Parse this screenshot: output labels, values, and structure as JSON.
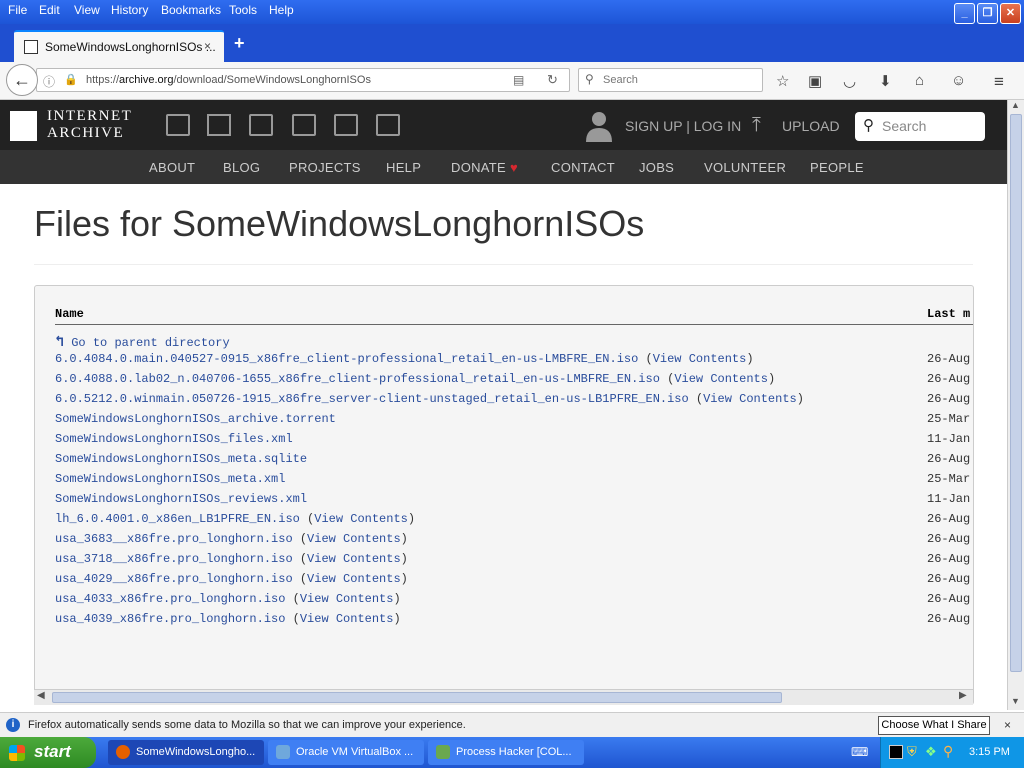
{
  "menu": [
    "File",
    "Edit",
    "View",
    "History",
    "Bookmarks",
    "Tools",
    "Help"
  ],
  "tab": {
    "title": "SomeWindowsLonghornISOs ...",
    "close": "×",
    "new_tab": "+"
  },
  "urlbar": {
    "scheme": "https://",
    "host": "archive.org",
    "path": "/download/SomeWindowsLonghornISOs"
  },
  "search": {
    "placeholder": "Search"
  },
  "ia": {
    "logo_line1": "INTERNET",
    "logo_line2": "ARCHIVE",
    "signup": "SIGN UP | LOG IN",
    "upload": "UPLOAD",
    "search_placeholder": "Search",
    "nav": [
      "ABOUT",
      "BLOG",
      "PROJECTS",
      "HELP",
      "DONATE",
      "CONTACT",
      "JOBS",
      "VOLUNTEER",
      "PEOPLE"
    ],
    "heart_color": "#d6282f"
  },
  "page": {
    "title": "Files for SomeWindowsLonghornISOs",
    "col_name": "Name",
    "col_last": "Last m",
    "parent": "Go to parent directory",
    "view_contents": "View Contents",
    "files": [
      {
        "name": "6.0.4084.0.main.040527-0915_x86fre_client-professional_retail_en-us-LMBFRE_EN.iso",
        "vc": true,
        "date": "26-Aug"
      },
      {
        "name": "6.0.4088.0.lab02_n.040706-1655_x86fre_client-professional_retail_en-us-LMBFRE_EN.iso",
        "vc": true,
        "date": "26-Aug"
      },
      {
        "name": "6.0.5212.0.winmain.050726-1915_x86fre_server-client-unstaged_retail_en-us-LB1PFRE_EN.iso",
        "vc": true,
        "date": "26-Aug"
      },
      {
        "name": "SomeWindowsLonghornISOs_archive.torrent",
        "vc": false,
        "date": "25-Mar"
      },
      {
        "name": "SomeWindowsLonghornISOs_files.xml",
        "vc": false,
        "date": "11-Jan"
      },
      {
        "name": "SomeWindowsLonghornISOs_meta.sqlite",
        "vc": false,
        "date": "26-Aug"
      },
      {
        "name": "SomeWindowsLonghornISOs_meta.xml",
        "vc": false,
        "date": "25-Mar"
      },
      {
        "name": "SomeWindowsLonghornISOs_reviews.xml",
        "vc": false,
        "date": "11-Jan"
      },
      {
        "name": "lh_6.0.4001.0_x86en_LB1PFRE_EN.iso",
        "vc": true,
        "date": "26-Aug"
      },
      {
        "name": "usa_3683__x86fre.pro_longhorn.iso",
        "vc": true,
        "date": "26-Aug"
      },
      {
        "name": "usa_3718__x86fre.pro_longhorn.iso",
        "vc": true,
        "date": "26-Aug"
      },
      {
        "name": "usa_4029__x86fre.pro_longhorn.iso",
        "vc": true,
        "date": "26-Aug"
      },
      {
        "name": "usa_4033_x86fre.pro_longhorn.iso",
        "vc": true,
        "date": "26-Aug"
      },
      {
        "name": "usa_4039_x86fre.pro_longhorn.iso",
        "vc": true,
        "date": "26-Aug"
      }
    ]
  },
  "notification": {
    "text": "Firefox automatically sends some data to Mozilla so that we can improve your experience.",
    "button": "Choose What I Share",
    "close": "×"
  },
  "taskbar": {
    "start": "start",
    "tasks": [
      "SomeWindowsLongho...",
      "Oracle VM VirtualBox ...",
      "Process Hacker [COL..."
    ],
    "clock": "3:15 PM"
  }
}
